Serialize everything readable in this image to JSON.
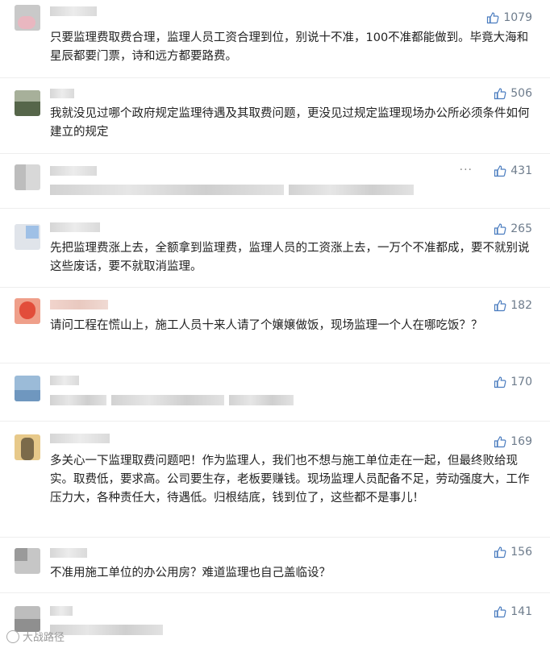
{
  "comments": [
    {
      "likes": "1079",
      "text": "只要监理费取费合理，监理人员工资合理到位，别说十不准，100不准都能做到。毕竟大海和星辰都要门票，诗和远方都要路费。"
    },
    {
      "likes": "506",
      "text": "我就没见过哪个政府规定监理待遇及其取费问题，更没见过规定监理现场办公所必须条件如何建立的规定"
    },
    {
      "likes": "431",
      "text": ""
    },
    {
      "likes": "265",
      "text": "先把监理费涨上去，全额拿到监理费，监理人员的工资涨上去，一万个不准都成，要不就别说这些废话，要不就取消监理。"
    },
    {
      "likes": "182",
      "text": "请问工程在慌山上，施工人员十来人请了个嬢嬢做饭，现场监理一个人在哪吃饭？？"
    },
    {
      "likes": "170",
      "text": ""
    },
    {
      "likes": "169",
      "text": "多关心一下监理取费问题吧！作为监理人，我们也不想与施工单位走在一起，但最终败给现实。取费低，要求高。公司要生存，老板要赚钱。现场监理人员配备不足，劳动强度大，工作压力大，各种责任大，待遇低。归根结底，钱到位了，这些都不是事儿！"
    },
    {
      "likes": "156",
      "text": "不准用施工单位的办公用房？难道监理也自己盖临设？"
    },
    {
      "likes": "141",
      "text": ""
    }
  ],
  "more_menu": "···",
  "watermark": "大战路径",
  "colors": {
    "likes": "#6e7c8c",
    "text": "#222222",
    "divider": "#eeeeee"
  }
}
